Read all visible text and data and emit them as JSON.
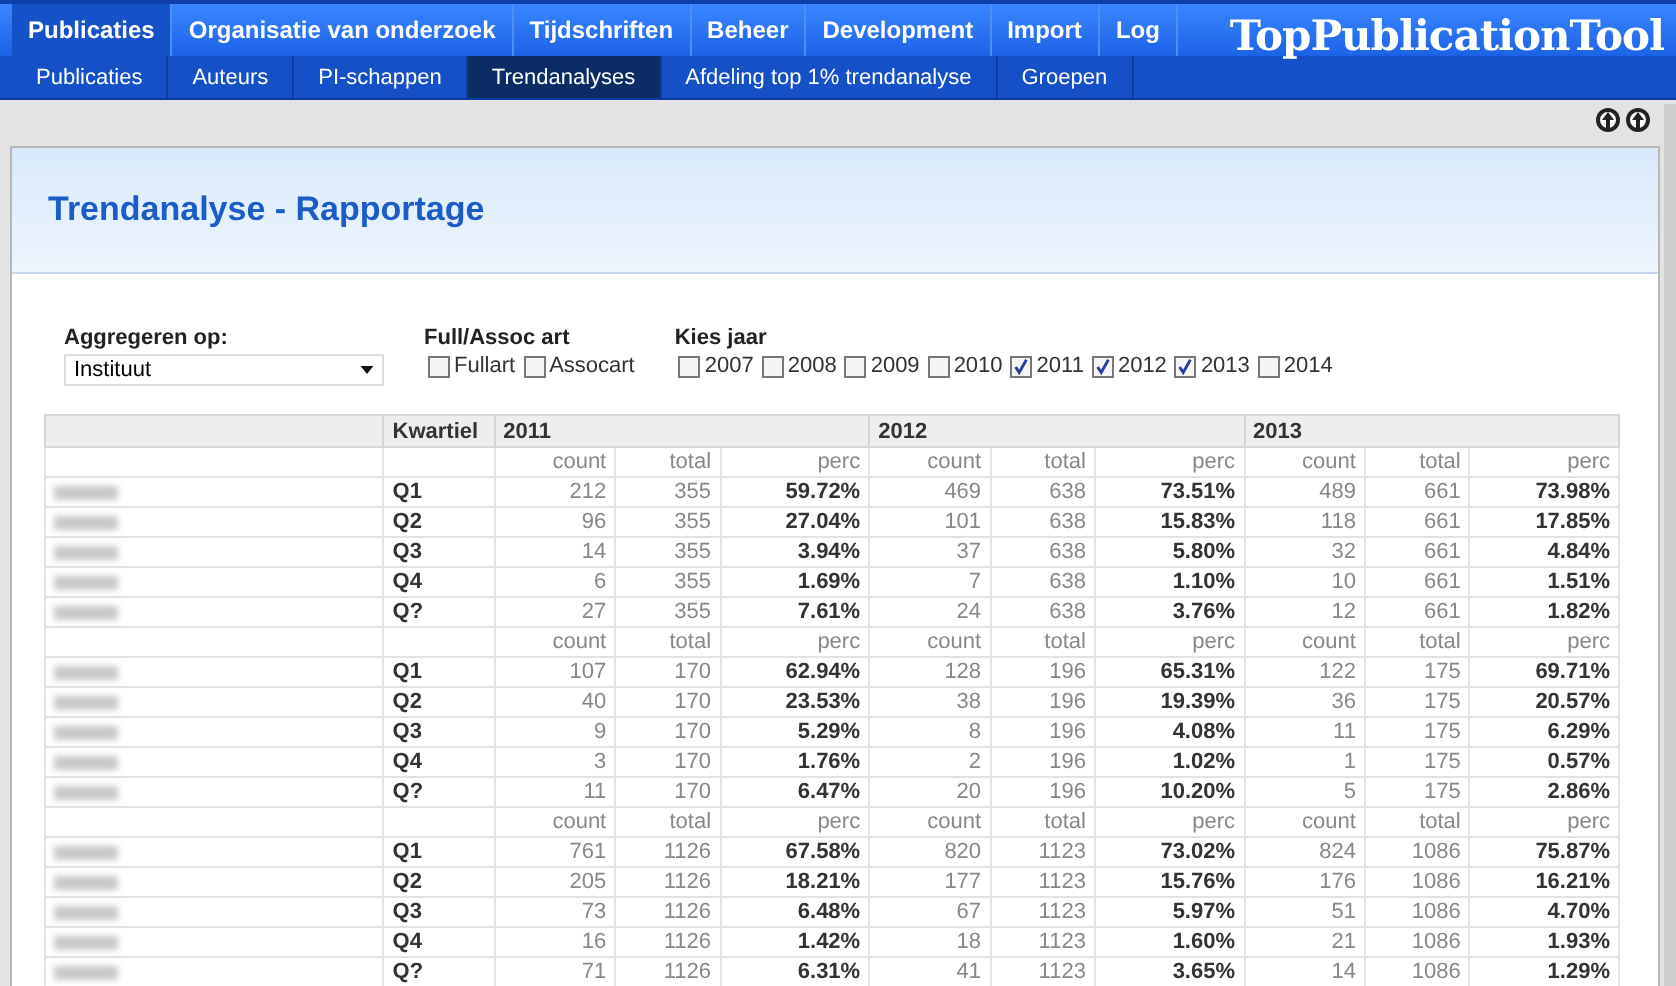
{
  "nav": {
    "tabs": [
      {
        "label": "Publicaties",
        "selected": true
      },
      {
        "label": "Organisatie van onderzoek",
        "selected": false
      },
      {
        "label": "Tijdschriften",
        "selected": false
      },
      {
        "label": "Beheer",
        "selected": false
      },
      {
        "label": "Development",
        "selected": false
      },
      {
        "label": "Import",
        "selected": false
      },
      {
        "label": "Log",
        "selected": false
      }
    ],
    "logo": "TopPublicationTool",
    "subtabs": [
      {
        "label": "Publicaties",
        "selected": false
      },
      {
        "label": "Auteurs",
        "selected": false
      },
      {
        "label": "PI-schappen",
        "selected": false
      },
      {
        "label": "Trendanalyses",
        "selected": true
      },
      {
        "label": "Afdeling top 1% trendanalyse",
        "selected": false
      },
      {
        "label": "Groepen",
        "selected": false
      }
    ]
  },
  "page": {
    "title": "Trendanalyse - Rapportage"
  },
  "filters": {
    "aggregate": {
      "label": "Aggregeren op:",
      "value": "Instituut"
    },
    "article": {
      "label": "Full/Assoc art",
      "options": [
        {
          "label": "Fullart",
          "checked": false
        },
        {
          "label": "Assocart",
          "checked": false
        }
      ]
    },
    "years": {
      "label": "Kies jaar",
      "options": [
        {
          "label": "2007",
          "checked": false
        },
        {
          "label": "2008",
          "checked": false
        },
        {
          "label": "2009",
          "checked": false
        },
        {
          "label": "2010",
          "checked": false
        },
        {
          "label": "2011",
          "checked": true
        },
        {
          "label": "2012",
          "checked": true
        },
        {
          "label": "2013",
          "checked": true
        },
        {
          "label": "2014",
          "checked": false
        }
      ]
    }
  },
  "table": {
    "quarter_heading": "Kwartiel",
    "years": [
      "2011",
      "2012",
      "2013"
    ],
    "groups": [
      {
        "subheader": [
          "count",
          "total",
          "perc",
          "count",
          "total",
          "perc",
          "count",
          "total",
          "perc"
        ],
        "rows": [
          {
            "quarter": "Q1",
            "cells": [
              "212",
              "355",
              "59.72%",
              "469",
              "638",
              "73.51%",
              "489",
              "661",
              "73.98%"
            ]
          },
          {
            "quarter": "Q2",
            "cells": [
              "96",
              "355",
              "27.04%",
              "101",
              "638",
              "15.83%",
              "118",
              "661",
              "17.85%"
            ]
          },
          {
            "quarter": "Q3",
            "cells": [
              "14",
              "355",
              "3.94%",
              "37",
              "638",
              "5.80%",
              "32",
              "661",
              "4.84%"
            ]
          },
          {
            "quarter": "Q4",
            "cells": [
              "6",
              "355",
              "1.69%",
              "7",
              "638",
              "1.10%",
              "10",
              "661",
              "1.51%"
            ]
          },
          {
            "quarter": "Q?",
            "cells": [
              "27",
              "355",
              "7.61%",
              "24",
              "638",
              "3.76%",
              "12",
              "661",
              "1.82%"
            ]
          }
        ]
      },
      {
        "subheader": [
          "count",
          "total",
          "perc",
          "count",
          "total",
          "perc",
          "count",
          "total",
          "perc"
        ],
        "rows": [
          {
            "quarter": "Q1",
            "cells": [
              "107",
              "170",
              "62.94%",
              "128",
              "196",
              "65.31%",
              "122",
              "175",
              "69.71%"
            ]
          },
          {
            "quarter": "Q2",
            "cells": [
              "40",
              "170",
              "23.53%",
              "38",
              "196",
              "19.39%",
              "36",
              "175",
              "20.57%"
            ]
          },
          {
            "quarter": "Q3",
            "cells": [
              "9",
              "170",
              "5.29%",
              "8",
              "196",
              "4.08%",
              "11",
              "175",
              "6.29%"
            ]
          },
          {
            "quarter": "Q4",
            "cells": [
              "3",
              "170",
              "1.76%",
              "2",
              "196",
              "1.02%",
              "1",
              "175",
              "0.57%"
            ]
          },
          {
            "quarter": "Q?",
            "cells": [
              "11",
              "170",
              "6.47%",
              "20",
              "196",
              "10.20%",
              "5",
              "175",
              "2.86%"
            ]
          }
        ]
      },
      {
        "subheader": [
          "count",
          "total",
          "perc",
          "count",
          "total",
          "perc",
          "count",
          "total",
          "perc"
        ],
        "rows": [
          {
            "quarter": "Q1",
            "cells": [
              "761",
              "1126",
              "67.58%",
              "820",
              "1123",
              "73.02%",
              "824",
              "1086",
              "75.87%"
            ]
          },
          {
            "quarter": "Q2",
            "cells": [
              "205",
              "1126",
              "18.21%",
              "177",
              "1123",
              "15.76%",
              "176",
              "1086",
              "16.21%"
            ]
          },
          {
            "quarter": "Q3",
            "cells": [
              "73",
              "1126",
              "6.48%",
              "67",
              "1123",
              "5.97%",
              "51",
              "1086",
              "4.70%"
            ]
          },
          {
            "quarter": "Q4",
            "cells": [
              "16",
              "1126",
              "1.42%",
              "18",
              "1123",
              "1.60%",
              "21",
              "1086",
              "1.93%"
            ]
          },
          {
            "quarter": "Q?",
            "cells": [
              "71",
              "1126",
              "6.31%",
              "41",
              "1123",
              "3.65%",
              "14",
              "1086",
              "1.29%"
            ]
          }
        ]
      }
    ]
  }
}
